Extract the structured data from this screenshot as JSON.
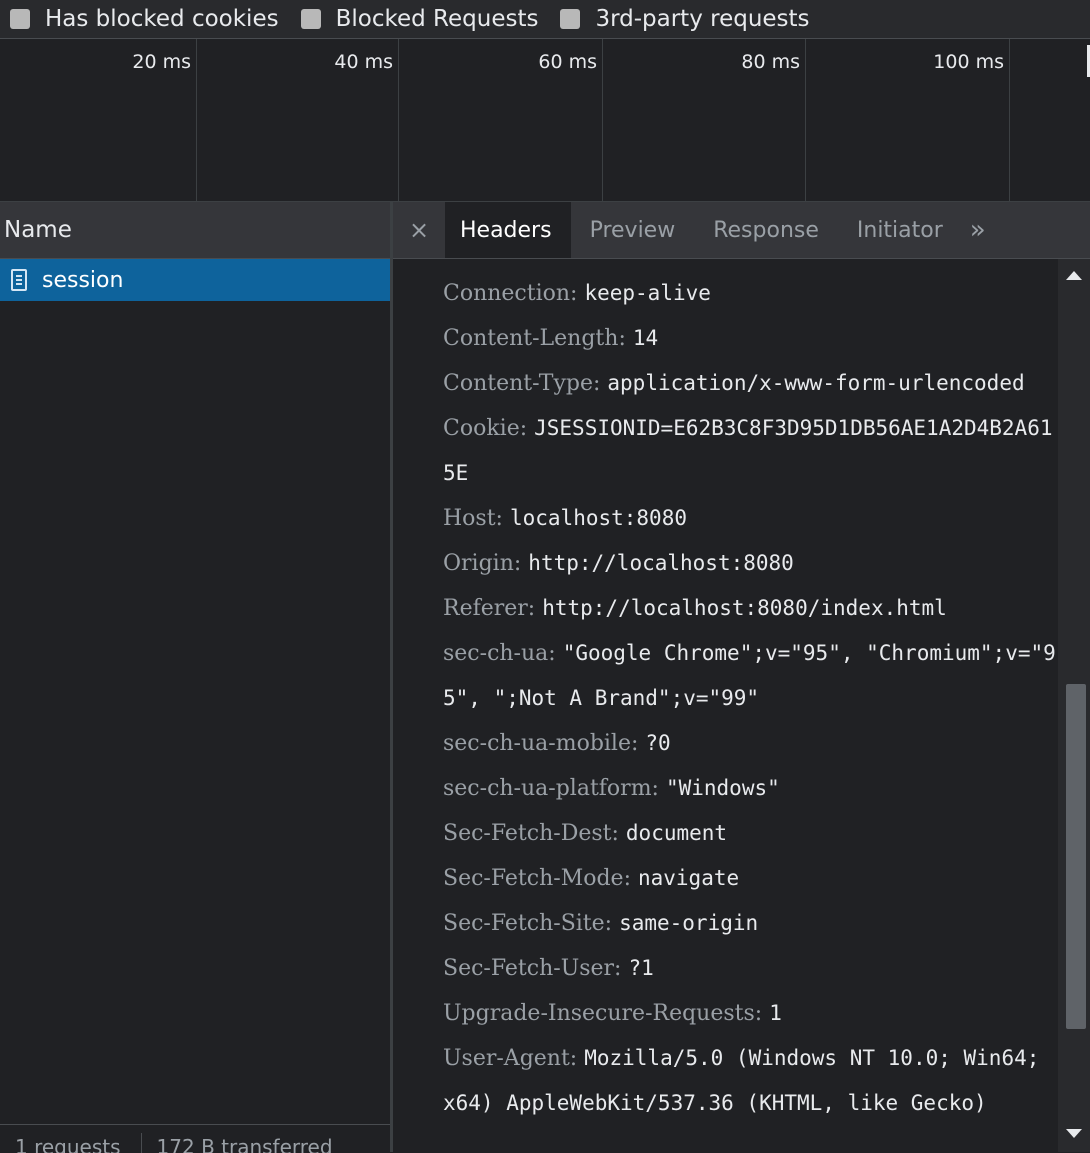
{
  "filters": [
    {
      "label": "Has blocked cookies",
      "checked": false
    },
    {
      "label": "Blocked Requests",
      "checked": false
    },
    {
      "label": "3rd-party requests",
      "checked": false
    }
  ],
  "timeline": {
    "ticks": [
      "20 ms",
      "40 ms",
      "60 ms",
      "80 ms",
      "100 ms"
    ]
  },
  "request_list": {
    "column_name": "Name",
    "requests": [
      {
        "name": "session",
        "selected": true
      }
    ],
    "summary": {
      "requests": "1 requests",
      "transferred": "172 B transferred"
    }
  },
  "detail": {
    "close_glyph": "×",
    "more_glyph": "»",
    "tabs": [
      "Headers",
      "Preview",
      "Response",
      "Initiator"
    ],
    "active_tab": "Headers",
    "headers": [
      {
        "name": "Connection:",
        "value": "keep-alive"
      },
      {
        "name": "Content-Length:",
        "value": "14"
      },
      {
        "name": "Content-Type:",
        "value": "application/x-www-form-urlencoded"
      },
      {
        "name": "Cookie:",
        "value": "JSESSIONID=E62B3C8F3D95D1DB56AE1A2D4B2A615E"
      },
      {
        "name": "Host:",
        "value": "localhost:8080"
      },
      {
        "name": "Origin:",
        "value": "http://localhost:8080"
      },
      {
        "name": "Referer:",
        "value": "http://localhost:8080/index.html"
      },
      {
        "name": "sec-ch-ua:",
        "value": "\"Google Chrome\";v=\"95\", \"Chromium\";v=\"95\", \";Not A Brand\";v=\"99\""
      },
      {
        "name": "sec-ch-ua-mobile:",
        "value": "?0"
      },
      {
        "name": "sec-ch-ua-platform:",
        "value": "\"Windows\""
      },
      {
        "name": "Sec-Fetch-Dest:",
        "value": "document"
      },
      {
        "name": "Sec-Fetch-Mode:",
        "value": "navigate"
      },
      {
        "name": "Sec-Fetch-Site:",
        "value": "same-origin"
      },
      {
        "name": "Sec-Fetch-User:",
        "value": "?1"
      },
      {
        "name": "Upgrade-Insecure-Requests:",
        "value": "1"
      },
      {
        "name": "User-Agent:",
        "value": "Mozilla/5.0 (Windows NT 10.0; Win64; x64) AppleWebKit/537.36 (KHTML, like Gecko)"
      }
    ]
  },
  "colors": {
    "background": "#202124",
    "selected_row": "#0e639c",
    "header_name": "#9aa0a6",
    "header_value": "#e8eaed"
  },
  "icons": {
    "request_type": "document-icon",
    "close": "close-icon",
    "more_tabs": "chevron-double-right-icon"
  }
}
